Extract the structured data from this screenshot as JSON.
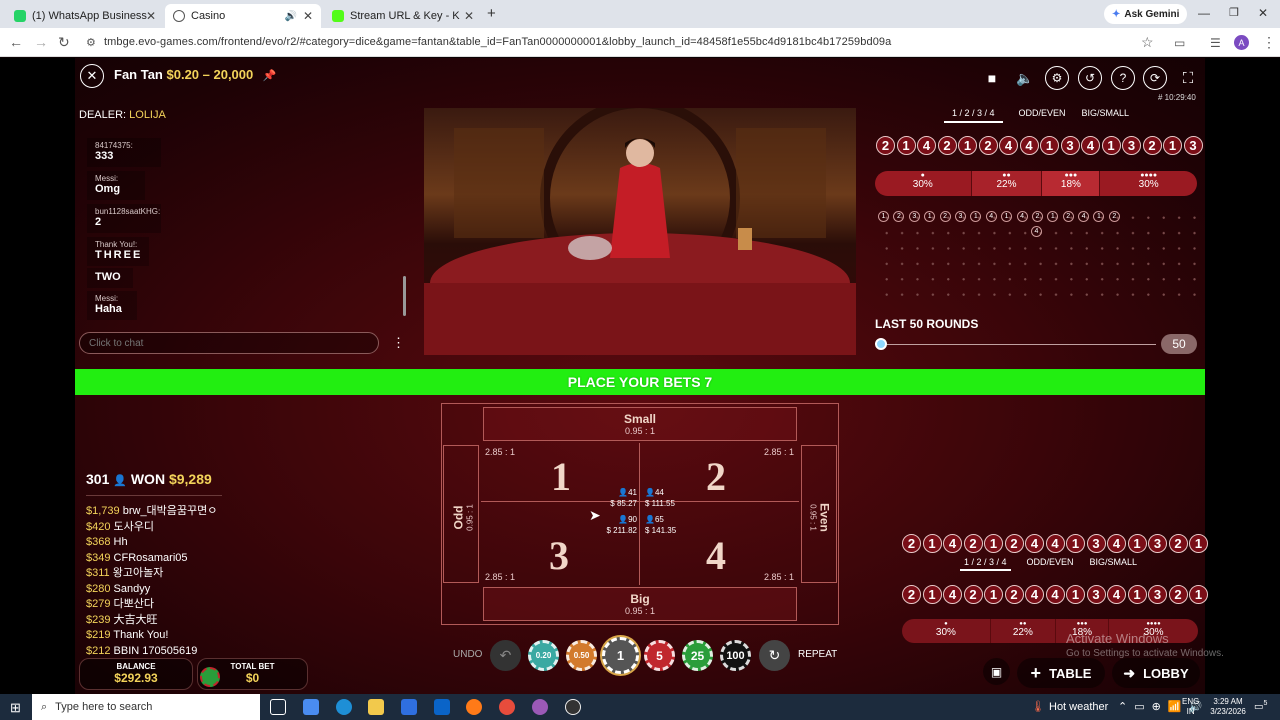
{
  "browser": {
    "tabs": [
      {
        "title": "(1) WhatsApp Business"
      },
      {
        "title": "Casino"
      },
      {
        "title": "Stream URL & Key - Kick Dashb"
      }
    ],
    "ask_gemini": "Ask Gemini",
    "url": "tmbge.evo-games.com/frontend/evo/r2/#category=dice&game=fantan&table_id=FanTan0000000001&lobby_launch_id=48458f1e55bc4d9181bc4b17259bd09a",
    "profile_initial": "A"
  },
  "game": {
    "title": "Fan Tan",
    "limits": "$0.20 – 20,000",
    "clock": "# 10:29:40",
    "dealer_label": "DEALER:",
    "dealer_name": "LOLIJA",
    "chat": [
      {
        "name": "84174375:",
        "msg": "333"
      },
      {
        "name": "Messi:",
        "msg": "Omg"
      },
      {
        "name": "bun1128saatKHG:",
        "msg": "2"
      },
      {
        "name": "Thank You!:",
        "msg": "THREE"
      },
      {
        "name": "",
        "msg": "TWO"
      },
      {
        "name": "Messi:",
        "msg": "Haha"
      }
    ],
    "chat_placeholder": "Click to chat",
    "tabs": [
      "1 / 2 / 3 / 4",
      "ODD/EVEN",
      "BIG/SMALL"
    ],
    "history_top": [
      "2",
      "1",
      "4",
      "2",
      "1",
      "2",
      "4",
      "4",
      "1",
      "3",
      "4",
      "1",
      "3",
      "2",
      "1",
      "3"
    ],
    "percentages": [
      "30%",
      "22%",
      "18%",
      "30%"
    ],
    "bead_row1": [
      "1",
      "2",
      "3",
      "1",
      "2",
      "3",
      "1",
      "4",
      "1",
      "4",
      "2",
      "1",
      "2",
      "4",
      "1",
      "2"
    ],
    "bead_row2_extra": "4",
    "last_rounds_label": "LAST 50 ROUNDS",
    "last_rounds_value": "50",
    "banner": "PLACE YOUR BETS 7",
    "bet_table": {
      "small_label": "Small",
      "small_odds": "0.95 : 1",
      "big_label": "Big",
      "big_odds": "0.95 : 1",
      "odd_label": "Odd",
      "odd_odds": "0.95 : 1",
      "even_label": "Even",
      "even_odds": "0.95 : 1",
      "cells": [
        {
          "num": "1",
          "odds": "2.85 : 1",
          "players": "41",
          "amount": "$ 85.27"
        },
        {
          "num": "2",
          "odds": "2.85 : 1",
          "players": "44",
          "amount": "$ 111.55"
        },
        {
          "num": "3",
          "odds": "2.85 : 1",
          "players": "90",
          "amount": "$ 211.82"
        },
        {
          "num": "4",
          "odds": "2.85 : 1",
          "players": "65",
          "amount": "$ 141.35"
        }
      ]
    },
    "winners_count": "301",
    "won_label": "WON",
    "won_amount": "$9,289",
    "winners": [
      {
        "amt": "$1,739",
        "name": "brw_대박음꿈꾸면ㅇ"
      },
      {
        "amt": "$420",
        "name": "도사우디"
      },
      {
        "amt": "$368",
        "name": "Hh"
      },
      {
        "amt": "$349",
        "name": "CFRosamari05"
      },
      {
        "amt": "$311",
        "name": "왕고아놀자"
      },
      {
        "amt": "$280",
        "name": "Sandyy"
      },
      {
        "amt": "$279",
        "name": "다뽀산다"
      },
      {
        "amt": "$239",
        "name": "大吉大旺"
      },
      {
        "amt": "$219",
        "name": "Thank You!"
      },
      {
        "amt": "$212",
        "name": "BBIN 170505619"
      }
    ],
    "balance_label": "BALANCE",
    "balance_value": "$292.93",
    "total_bet_label": "TOTAL BET",
    "total_bet_value": "$0",
    "undo_label": "UNDO",
    "repeat_label": "REPEAT",
    "chips": [
      "0.20",
      "0.50",
      "1",
      "5",
      "25",
      "100"
    ],
    "history_bottom1": [
      "2",
      "1",
      "4",
      "2",
      "1",
      "2",
      "4",
      "4",
      "1",
      "3",
      "4",
      "1",
      "3",
      "2",
      "1"
    ],
    "history_bottom2": [
      "2",
      "1",
      "4",
      "2",
      "1",
      "2",
      "4",
      "4",
      "1",
      "3",
      "4",
      "1",
      "3",
      "2",
      "1"
    ],
    "bottom_percentages": [
      "30%",
      "22%",
      "18%",
      "30%"
    ],
    "table_btn": "TABLE",
    "lobby_btn": "LOBBY",
    "watermark_title": "Activate Windows",
    "watermark_sub": "Go to Settings to activate Windows."
  },
  "taskbar": {
    "search_placeholder": "Type here to search",
    "weather": "Hot weather",
    "lang1": "ENG",
    "lang2": "IN",
    "time": "3:29 AM",
    "date": "3/23/2026",
    "notif": "5"
  }
}
